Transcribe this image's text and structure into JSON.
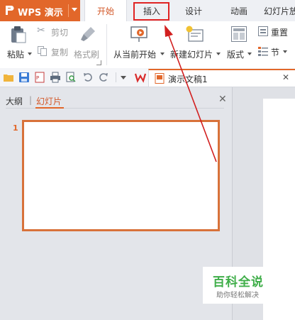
{
  "app": {
    "name": "WPS 演示",
    "accent_color": "#e2672a"
  },
  "tabs": [
    "开始",
    "插入",
    "设计",
    "动画",
    "幻灯片放"
  ],
  "active_tab": "开始",
  "highlighted_tab": "插入",
  "ribbon": {
    "paste": "粘贴",
    "cut": "剪切",
    "copy": "复制",
    "format_painter": "格式刷",
    "from_current": "从当前开始",
    "new_slide": "新建幻灯片",
    "layout": "版式",
    "reset": "重置",
    "section": "节"
  },
  "quick_access": {
    "icons": [
      "folder-icon",
      "save-icon",
      "export-pdf-icon",
      "print-icon",
      "print-preview-icon",
      "undo-icon",
      "redo-icon",
      "dropdown-icon"
    ]
  },
  "document_tab": {
    "title": "演示文稿1",
    "close": "✕"
  },
  "panel": {
    "tab_outline": "大纲",
    "divider": "|",
    "tab_slides": "幻灯片",
    "close": "✕",
    "slide_number": "1"
  },
  "watermark": {
    "title": "百科全说",
    "subtitle": "助你轻松解决"
  }
}
